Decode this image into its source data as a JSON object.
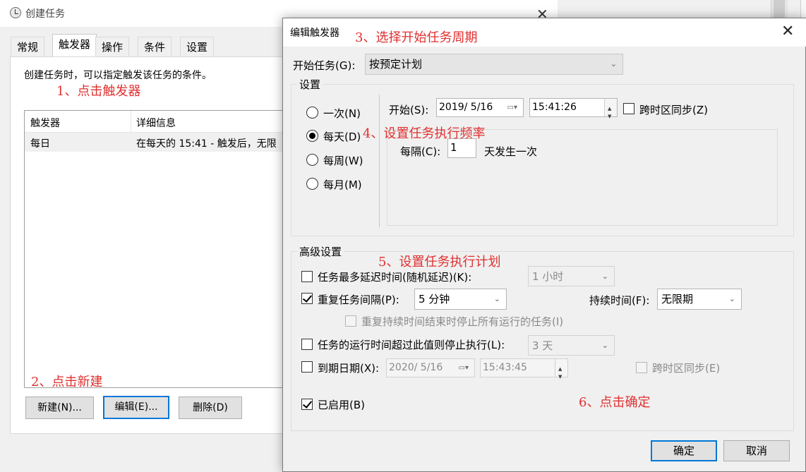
{
  "background_window": {
    "title": "创建任务",
    "close_glyph": "✕",
    "tabs": [
      "常规",
      "触发器",
      "操作",
      "条件",
      "设置"
    ],
    "active_tab": "触发器",
    "description": "创建任务时，可以指定触发该任务的条件。",
    "trigger_list": {
      "columns": [
        "触发器",
        "详细信息"
      ],
      "rows": [
        {
          "trigger": "每日",
          "details": "在每天的 15:41 - 触发后，无限"
        }
      ]
    },
    "buttons": {
      "new": "新建(N)...",
      "edit": "编辑(E)...",
      "delete": "删除(D)"
    }
  },
  "dialog": {
    "title": "编辑触发器",
    "close_glyph": "✕",
    "begin_task_label": "开始任务(G):",
    "begin_task_value": "按预定计划",
    "settings_group": "设置",
    "radios": [
      {
        "label": "一次(N)",
        "checked": false
      },
      {
        "label": "每天(D)",
        "checked": true
      },
      {
        "label": "每周(W)",
        "checked": false
      },
      {
        "label": "每月(M)",
        "checked": false
      }
    ],
    "start_label": "开始(S):",
    "start_date": "2019/  5/16",
    "start_time": "15:41:26",
    "sync_timezone_label": "跨时区同步(Z)",
    "recur_label": "每隔(C):",
    "recur_value": "1",
    "recur_unit": "天发生一次",
    "advanced_group": "高级设置",
    "delay": {
      "label": "任务最多延迟时间(随机延迟)(K):",
      "checked": false,
      "value": "1 小时"
    },
    "repeat": {
      "label": "重复任务间隔(P):",
      "checked": true,
      "value": "5 分钟",
      "duration_label": "持续时间(F):",
      "duration_value": "无限期"
    },
    "stop_at_end": {
      "label": "重复持续时间结束时停止所有运行的任务(I)",
      "checked": false
    },
    "stop_if_longer": {
      "label": "任务的运行时间超过此值则停止执行(L):",
      "checked": false,
      "value": "3 天"
    },
    "expire": {
      "label": "到期日期(X):",
      "checked": false,
      "date": "2020/  5/16",
      "time": "15:43:45",
      "sync_label": "跨时区同步(E)"
    },
    "enabled": {
      "label": "已启用(B)",
      "checked": true
    },
    "ok_label": "确定",
    "cancel_label": "取消"
  },
  "annotations": {
    "step1": "1、点击触发器",
    "step2": "2、点击新建",
    "step3": "3、选择开始任务周期",
    "step4": "4、设置任务执行频率",
    "step5": "5、设置任务执行计划",
    "step6": "6、点击确定"
  },
  "colors": {
    "annotation": "#e03030",
    "focus_border": "#0078d7",
    "window_bg": "#f0f0f0"
  }
}
